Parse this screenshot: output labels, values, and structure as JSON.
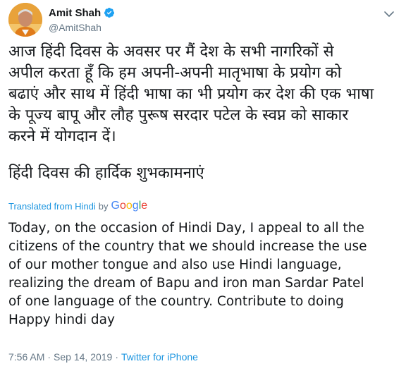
{
  "colors": {
    "text_primary": "#14171a",
    "text_secondary": "#657786",
    "link": "#1b95e0",
    "verified": "#1da1f2"
  },
  "author": {
    "display_name": "Amit Shah",
    "handle": "@AmitShah",
    "verified": true,
    "avatar_icon": "avatar-photo"
  },
  "tweet": {
    "hindi_lines": [
      "आज हिंदी दिवस के अवसर पर मैं देश के सभी नागरिकों से",
      "अपील करता हूँ कि हम अपनी-अपनी मातृभाषा के प्रयोग को",
      "बढाएं और साथ में हिंदी भाषा का भी प्रयोग कर देश की एक भाषा",
      "के पूज्य बापू और लौह पुरूष सरदार पटेल के स्वप्न को साकार",
      "करने में योगदान दें।"
    ],
    "hindi_greeting": "हिंदी दिवस की हार्दिक शुभकामनाएं",
    "translation": {
      "translated_from": "Translated from Hindi",
      "by": "by",
      "provider": "Google"
    },
    "english_lines": [
      "Today, on the occasion of Hindi Day, I appeal to all the",
      "citizens of the country that we should increase the use",
      "of our mother tongue and also use Hindi language,",
      "realizing the dream of Bapu and iron man Sardar Patel",
      "of one language of the country. Contribute to doing",
      "Happy hindi day"
    ]
  },
  "meta": {
    "time": "7:56 AM",
    "separator": "·",
    "date": "Sep 14, 2019",
    "source": "Twitter for iPhone"
  }
}
